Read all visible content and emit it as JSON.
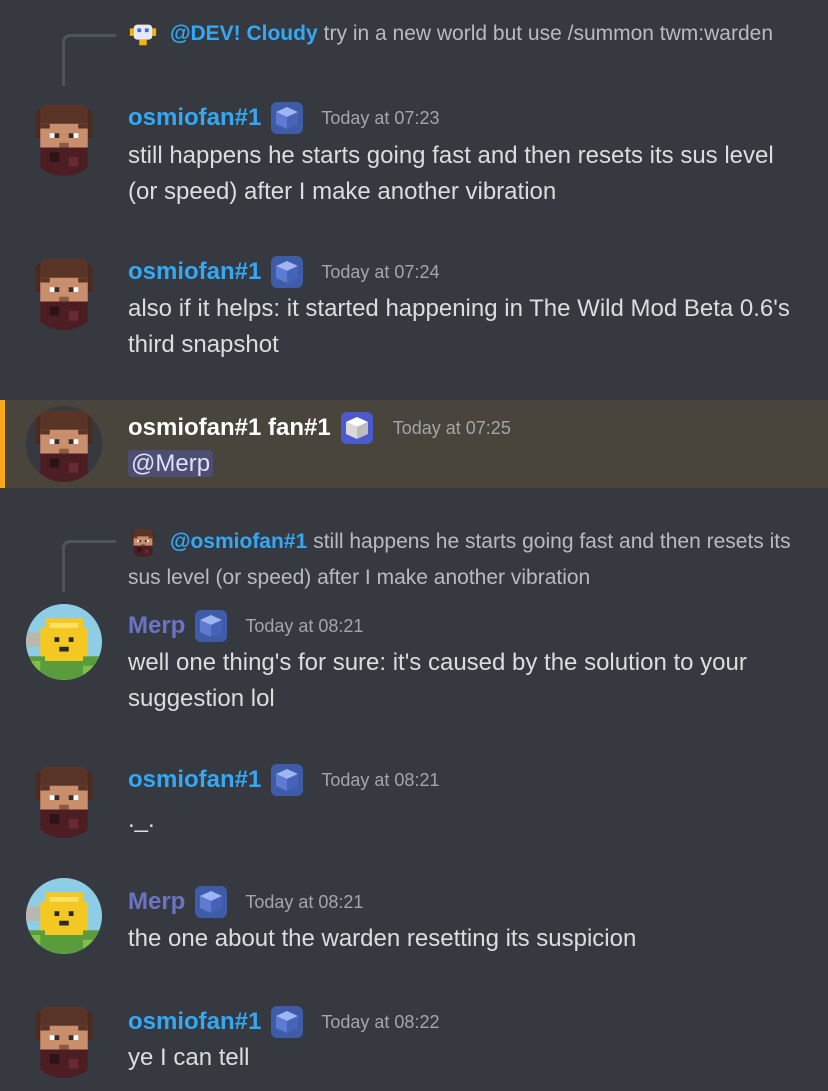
{
  "colors": {
    "background": "#36393f",
    "osmiofan_name": "#33a9f5",
    "merp_name": "#6b73c6",
    "fan_name": "#ffffff",
    "highlight_bg": "#49443c",
    "highlight_bar": "#faa81a"
  },
  "messages": [
    {
      "reply": {
        "author": "@DEV! Cloudy",
        "text": "try in a new world but use /summon twm:warden",
        "avatar_icon": "robot-avatar-icon"
      },
      "author": "osmiofan#1",
      "badge_icon": "blue-cube-icon",
      "timestamp": "Today at 07:23",
      "text": "still happens he starts going fast and then resets its sus level (or speed) after I make another vibration"
    },
    {
      "author": "osmiofan#1",
      "badge_icon": "blue-cube-icon",
      "timestamp": "Today at 07:24",
      "text": "also if it helps: it started happening in The Wild Mod Beta 0.6's third snapshot"
    },
    {
      "author": "osmiofan#1 fan#1",
      "badge_icon": "white-cube-icon",
      "timestamp": "Today at 07:25",
      "mention": "@Merp"
    },
    {
      "reply": {
        "author": "@osmiofan#1",
        "text": "still happens he starts going fast and then resets its sus level (or speed) after I make another vibration",
        "avatar_icon": "pixel-face-avatar-icon"
      },
      "author": "Merp",
      "badge_icon": "blue-cube-icon",
      "timestamp": "Today at 08:21",
      "text": "well one thing's for sure: it's caused by the solution to your suggestion lol"
    },
    {
      "author": "osmiofan#1",
      "badge_icon": "blue-cube-icon",
      "timestamp": "Today at 08:21",
      "text": "._."
    },
    {
      "author": "Merp",
      "badge_icon": "blue-cube-icon",
      "timestamp": "Today at 08:21",
      "text": "the one about the warden resetting its suspicion"
    },
    {
      "author": "osmiofan#1",
      "badge_icon": "blue-cube-icon",
      "timestamp": "Today at 08:22",
      "text": "ye I can tell"
    }
  ]
}
